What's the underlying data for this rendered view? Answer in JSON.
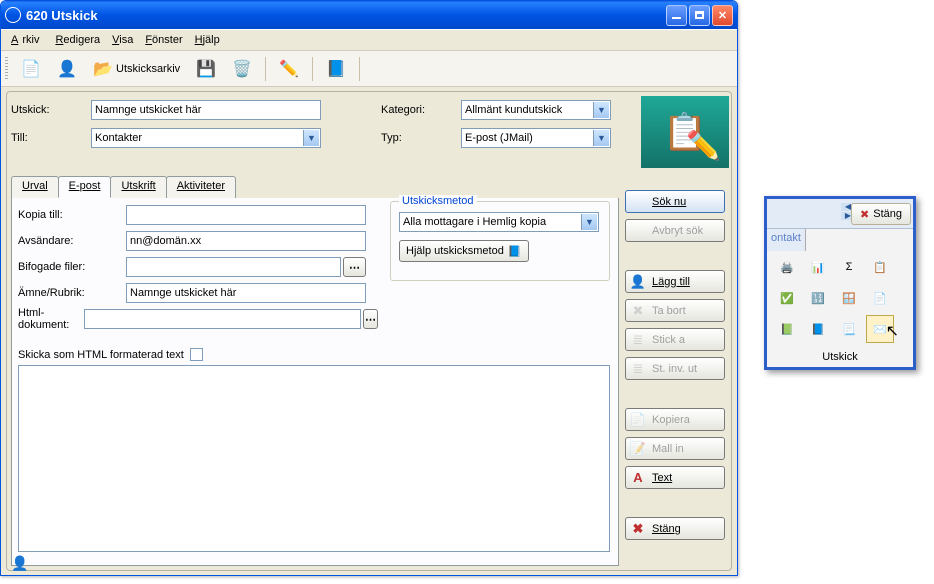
{
  "window": {
    "title": "620 Utskick"
  },
  "menu": {
    "arkiv": "Arkiv",
    "redigera": "Redigera",
    "visa": "Visa",
    "fonster": "Fönster",
    "hjalp": "Hjälp"
  },
  "toolbar": {
    "utskicksarkiv": "Utskicksarkiv"
  },
  "header": {
    "utskick_label": "Utskick:",
    "utskick_value": "Namnge utskicket här",
    "till_label": "Till:",
    "till_value": "Kontakter",
    "kategori_label": "Kategori:",
    "kategori_value": "Allmänt kundutskick",
    "typ_label": "Typ:",
    "typ_value": "E-post (JMail)"
  },
  "tabs": {
    "urval": "Urval",
    "epost": "E-post",
    "utskrift": "Utskrift",
    "aktiviteter": "Aktiviteter"
  },
  "form": {
    "kopia_label": "Kopia till:",
    "kopia_value": "",
    "avsandare_label": "Avsändare:",
    "avsandare_value": "nn@domän.xx",
    "bifogade_label": "Bifogade filer:",
    "bifogade_value": "",
    "amne_label": "Ämne/Rubrik:",
    "amne_value": "Namnge utskicket här",
    "html_label": "Html-dokument:",
    "html_value": "",
    "skicka_som": "Skicka som HTML formaterad text"
  },
  "fieldset": {
    "legend": "Utskicksmetod",
    "combo": "Alla mottagare i Hemlig kopia",
    "help": "Hjälp utskicksmetod"
  },
  "side": {
    "sok": "Sök nu",
    "avbryt": "Avbryt sök",
    "lagg": "Lägg till",
    "tabort": "Ta bort",
    "stick1": "Stick a",
    "stick2": "St. inv. ut",
    "kopiera": "Kopiera",
    "mallin": "Mall in",
    "text": "Text",
    "stang": "Stäng"
  },
  "popup": {
    "stang": "Stäng",
    "ontakt": "ontakt",
    "title": "Utskick"
  }
}
